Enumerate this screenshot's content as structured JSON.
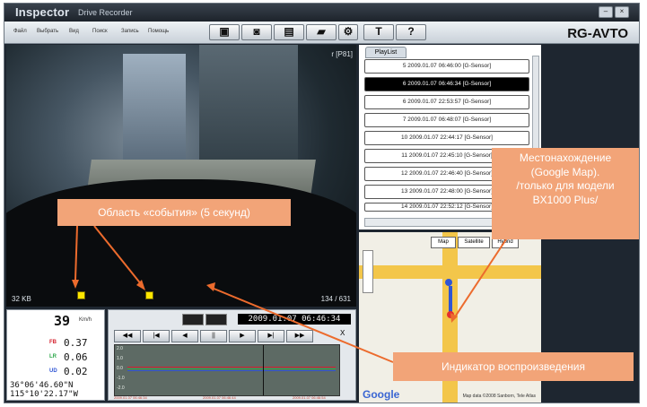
{
  "window": {
    "logo": "Inspector",
    "subtitle": "Drive Recorder",
    "brand": "RG-AVTO",
    "menu": [
      "Файл",
      "Выбрать",
      "Вид",
      "Поиск",
      "Запись",
      "Помощь"
    ],
    "toolbar_icons": [
      "folder-icon",
      "camera-icon",
      "printer-icon",
      "clapper-icon",
      "gear-icon",
      "text-icon"
    ],
    "help_label": "?"
  },
  "video": {
    "fps_label": "r [P81]",
    "size_label": "32 KB",
    "frame_label": "134 / 631"
  },
  "playlist": {
    "tab": "PlayList",
    "items": [
      "5  2009.01.07 06:46:00 [G-Sensor]",
      "6  2009.01.07 06:46:34 [G-Sensor]",
      "6  2009.01.07 22:53:57 [G-Sensor]",
      "7  2009.01.07 06:48:07 [G-Sensor]",
      "10  2009.01.07 22:44:17 [G-Sensor]",
      "11  2009.01.07 22:45:10 [G-Sensor]",
      "12  2009.01.07 22:46:40 [G-Sensor]",
      "13  2009.01.07 22:48:00 [G-Sensor]",
      "14  2009.01.07 22:52:12 [G-Sensor]"
    ],
    "selected_index": 1
  },
  "map": {
    "modes": [
      "Map",
      "Satellite",
      "Hybrid"
    ],
    "google": "Google",
    "copyright": "Map data ©2008 Sanborn, Tele Atlas"
  },
  "telemetry": {
    "speed": "39",
    "speed_unit": "Km/h",
    "axes": [
      {
        "label": "FB",
        "value": "0.37",
        "color": "#d4212d"
      },
      {
        "label": "LR",
        "value": "0.06",
        "color": "#2ea84b"
      },
      {
        "label": "UD",
        "value": "0.02",
        "color": "#2f55d4"
      }
    ],
    "lat": "36°06'46.60\"N",
    "lon": "115°10'22.17\"W"
  },
  "controls": {
    "timestamp": "2009.01.07 06:46:34",
    "buttons": [
      "◀◀",
      "|◀",
      "◀",
      "||",
      "▶",
      "▶|",
      "▶▶"
    ],
    "y_ticks": [
      "2.0",
      "1.0",
      "0.0",
      "-1.0",
      "-2.0"
    ],
    "time_ticks": [
      "2009.01.07 06:46:34",
      "2009.01.07 06:46:44",
      "2009.01.07 06:46:54"
    ],
    "axis_x": "X"
  },
  "callouts": {
    "event_area": "Область «события» (5 секунд)",
    "location": "Местонахождение\n(Google Map).\n/только для модели\nBX1000 Plus/",
    "playback": "Индикатор воспроизведения"
  }
}
